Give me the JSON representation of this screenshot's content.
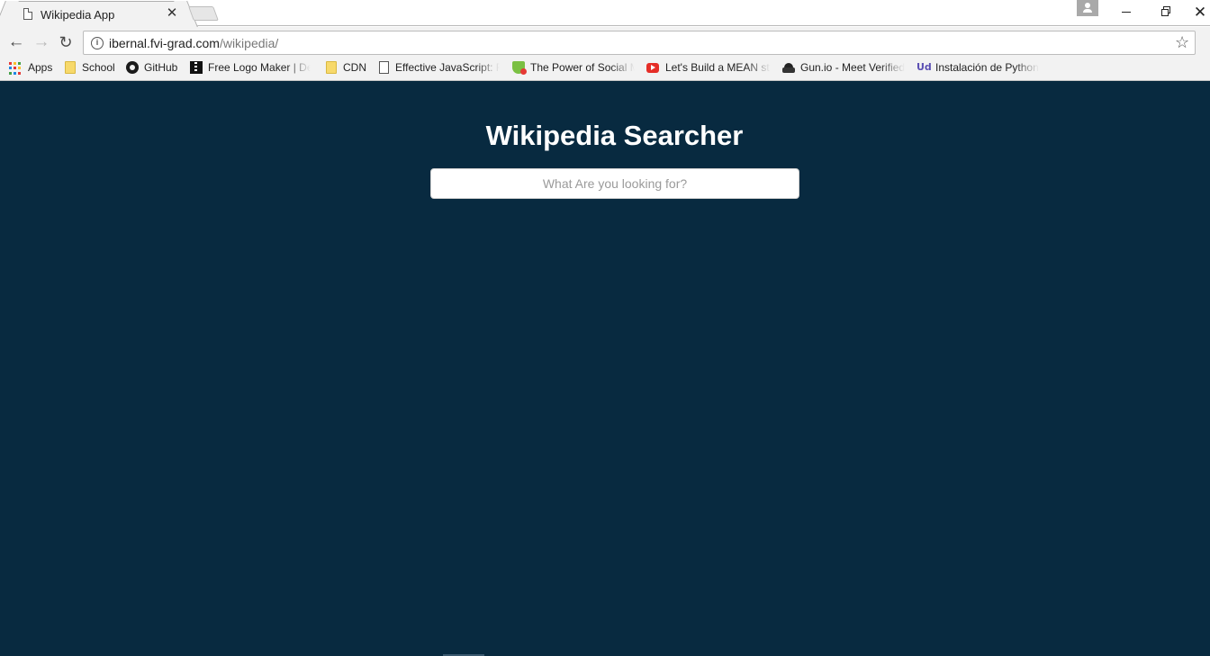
{
  "browser": {
    "tab": {
      "title": "Wikipedia App",
      "close_glyph": "✕"
    },
    "window_controls": {
      "close_glyph": "✕"
    },
    "address_bar": {
      "url_host": "ibernal.fvi-grad.com",
      "url_path": "/wikipedia/",
      "info_glyph": "i",
      "star_glyph": "☆"
    },
    "nav": {
      "back_glyph": "←",
      "forward_glyph": "→",
      "reload_glyph": "↻"
    },
    "bookmarks": [
      {
        "label": "Apps",
        "icon": "apps-grid-icon"
      },
      {
        "label": "School",
        "icon": "folder-icon"
      },
      {
        "label": "GitHub",
        "icon": "github-icon"
      },
      {
        "label": "Free Logo Maker | De",
        "icon": "logo-maker-icon"
      },
      {
        "label": "CDN",
        "icon": "folder-icon"
      },
      {
        "label": "Effective JavaScript: Fr",
        "icon": "page-icon"
      },
      {
        "label": "The Power of Social M",
        "icon": "shield-icon"
      },
      {
        "label": "Let's Build a MEAN st",
        "icon": "youtube-icon"
      },
      {
        "label": "Gun.io - Meet Verified",
        "icon": "spy-icon"
      },
      {
        "label": "Instalación de Python",
        "icon": "udemy-icon",
        "icon_text": "Ud"
      }
    ]
  },
  "page": {
    "title": "Wikipedia Searcher",
    "search": {
      "placeholder": "What Are you looking for?",
      "value": ""
    },
    "background_color": "#082a40"
  }
}
